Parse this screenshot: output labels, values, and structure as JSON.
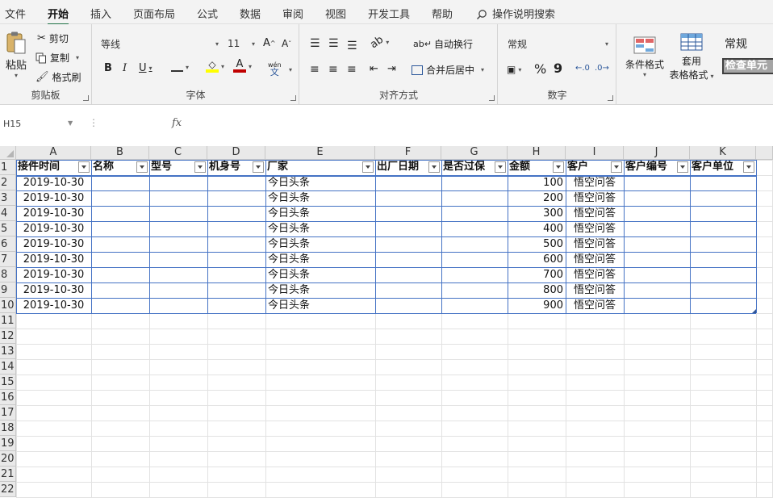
{
  "menu": {
    "tabs": [
      "文件",
      "开始",
      "插入",
      "页面布局",
      "公式",
      "数据",
      "审阅",
      "视图",
      "开发工具",
      "帮助"
    ],
    "active_index": 1,
    "search_label": "操作说明搜索"
  },
  "ribbon": {
    "clipboard": {
      "paste": "粘贴",
      "cut": "剪切",
      "copy": "复制",
      "format_painter": "格式刷",
      "label": "剪贴板"
    },
    "font": {
      "name": "等线",
      "size": "11",
      "grow": "A",
      "shrink": "A",
      "bold": "B",
      "italic": "I",
      "underline": "U",
      "phonetic": "wén",
      "label": "字体"
    },
    "alignment": {
      "wrap": "自动换行",
      "merge": "合并后居中",
      "label": "对齐方式"
    },
    "number": {
      "format": "常规",
      "percent": "%",
      "comma": "9",
      "label": "数字"
    },
    "styles": {
      "conditional": "条件格式",
      "table_1": "套用",
      "table_2": "表格格式",
      "normal": "常规",
      "check_cell": "检查单元"
    }
  },
  "formula_bar": {
    "name_box": "H15",
    "fx": "fx",
    "dots": "⋮"
  },
  "sheet": {
    "columns": [
      "A",
      "B",
      "C",
      "D",
      "E",
      "F",
      "G",
      "H",
      "I",
      "J",
      "K"
    ],
    "rows": [
      "1",
      "2",
      "3",
      "4",
      "5",
      "6",
      "7",
      "8",
      "9",
      "10",
      "11",
      "12",
      "13",
      "14",
      "15",
      "16",
      "17",
      "18",
      "19",
      "20",
      "21",
      "22"
    ],
    "headers": [
      "接件时间",
      "名称",
      "型号",
      "机身号",
      "厂家",
      "出厂日期",
      "是否过保",
      "金额",
      "客户",
      "客户编号",
      "客户单位"
    ],
    "records": [
      {
        "date": "2019-10-30",
        "maker": "今日头条",
        "amount": "100",
        "customer": "悟空问答"
      },
      {
        "date": "2019-10-30",
        "maker": "今日头条",
        "amount": "200",
        "customer": "悟空问答"
      },
      {
        "date": "2019-10-30",
        "maker": "今日头条",
        "amount": "300",
        "customer": "悟空问答"
      },
      {
        "date": "2019-10-30",
        "maker": "今日头条",
        "amount": "400",
        "customer": "悟空问答"
      },
      {
        "date": "2019-10-30",
        "maker": "今日头条",
        "amount": "500",
        "customer": "悟空问答"
      },
      {
        "date": "2019-10-30",
        "maker": "今日头条",
        "amount": "600",
        "customer": "悟空问答"
      },
      {
        "date": "2019-10-30",
        "maker": "今日头条",
        "amount": "700",
        "customer": "悟空问答"
      },
      {
        "date": "2019-10-30",
        "maker": "今日头条",
        "amount": "800",
        "customer": "悟空问答"
      },
      {
        "date": "2019-10-30",
        "maker": "今日头条",
        "amount": "900",
        "customer": "悟空问答"
      }
    ]
  },
  "colors": {
    "accent": "#217346",
    "table_border": "#4472c4",
    "fill_yellow": "#ffff00",
    "font_red": "#c00000"
  }
}
